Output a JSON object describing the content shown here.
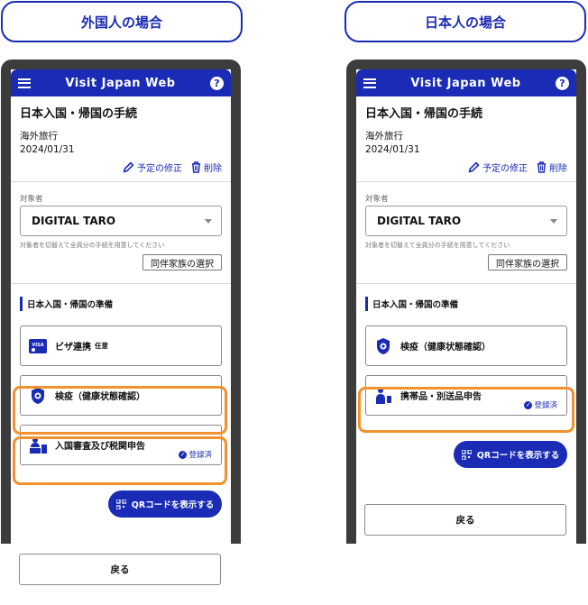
{
  "left": {
    "header": "外国人の場合",
    "app_title": "Visit Japan Web",
    "help": "?",
    "procedure": {
      "title": "日本入国・帰国の手続",
      "type": "海外旅行",
      "date": "2024/01/31"
    },
    "actions": {
      "edit": "予定の修正",
      "delete": "削除"
    },
    "target": {
      "label": "対象者",
      "value": "DIGITAL TARO",
      "hint": "対象者を切替えて全員分の手続を用意してください",
      "companion_button": "同伴家族の選択"
    },
    "section_title": "日本入国・帰国の準備",
    "cards": [
      {
        "label": "ビザ連携",
        "optional": "任意",
        "status": ""
      },
      {
        "label": "検疫（健康状態確認）",
        "status": ""
      },
      {
        "label": "入国審査及び税関申告",
        "status": "登録済"
      }
    ],
    "qr_button": "QRコードを表示する",
    "back_button": "戻る"
  },
  "right": {
    "header": "日本人の場合",
    "app_title": "Visit Japan Web",
    "help": "?",
    "procedure": {
      "title": "日本入国・帰国の手続",
      "type": "海外旅行",
      "date": "2024/01/31"
    },
    "actions": {
      "edit": "予定の修正",
      "delete": "削除"
    },
    "target": {
      "label": "対象者",
      "value": "DIGITAL TARO",
      "hint": "対象者を切替えて全員分の手続を用意してください",
      "companion_button": "同伴家族の選択"
    },
    "section_title": "日本入国・帰国の準備",
    "cards": [
      {
        "label": "検疫（健康状態確認）",
        "status": ""
      },
      {
        "label": "携帯品・別送品申告",
        "status": "登録済"
      }
    ],
    "qr_button": "QRコードを表示する",
    "back_button": "戻る"
  },
  "icons": {
    "menu": "menu-icon",
    "help": "help-icon",
    "edit": "pencil-icon",
    "delete": "trash-icon",
    "visa": "visa-card-icon",
    "quarantine": "virus-shield-icon",
    "immigration": "officer-desk-icon",
    "customs": "officer-luggage-icon",
    "qr": "qr-code-icon",
    "check": "check-circle-icon"
  },
  "colors": {
    "primary": "#1a2bb5",
    "highlight": "#f0922d",
    "phone_frame": "#3c3c3c"
  }
}
